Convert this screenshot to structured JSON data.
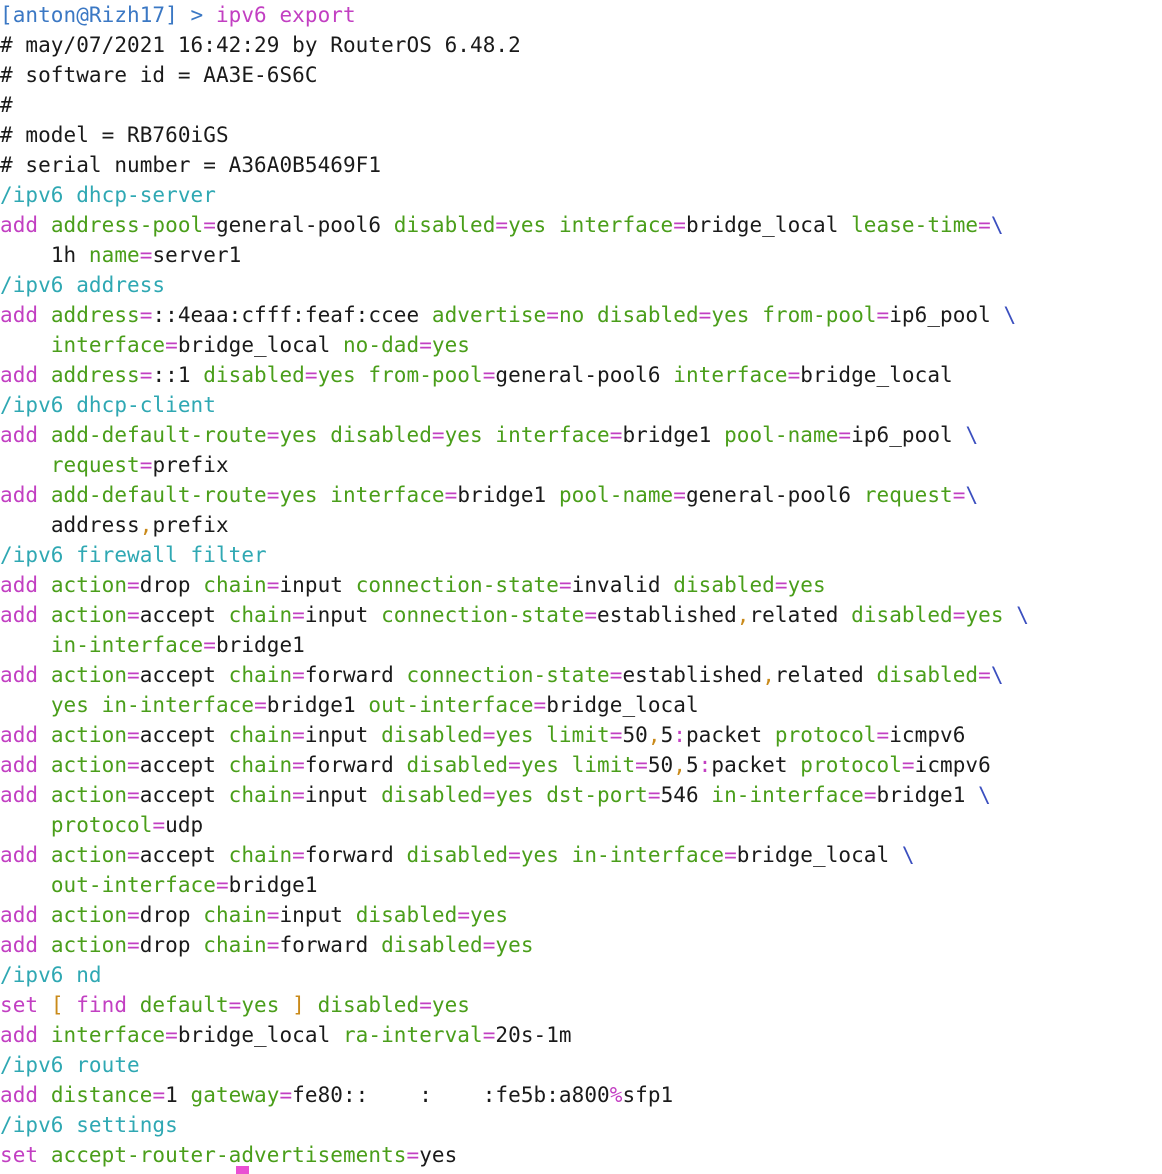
{
  "window": {
    "title": ""
  },
  "theme": {
    "background": "#ffffff",
    "prompt": "#3b78c4",
    "command": "#c23fc2",
    "path": "#2fa8b3",
    "verb": "#c23fc2",
    "param": "#4a9e1a",
    "value": "#1a1a1a",
    "continuation": "#3b4fbf",
    "punct": "#c98a1a",
    "cursor": "#e94fd3"
  },
  "lines": [
    [
      [
        "prompt",
        "[anton@Rizh17] > "
      ],
      [
        "cmd",
        "ipv6 "
      ],
      [
        "cmd",
        "export"
      ]
    ],
    [
      [
        "comment",
        "# may/07/2021 16:42:29 by RouterOS 6.48.2"
      ]
    ],
    [
      [
        "comment",
        "# software id = AA3E-6S6C"
      ]
    ],
    [
      [
        "comment",
        "#"
      ]
    ],
    [
      [
        "comment",
        "# model = RB760iGS"
      ]
    ],
    [
      [
        "comment",
        "# serial number = A36A0B5469F1"
      ]
    ],
    [
      [
        "path",
        "/ipv6 dhcp-server"
      ]
    ],
    [
      [
        "verb",
        "add "
      ],
      [
        "param",
        "address-pool"
      ],
      [
        "eq",
        "="
      ],
      [
        "value",
        "general-pool6 "
      ],
      [
        "param",
        "disabled"
      ],
      [
        "eq",
        "="
      ],
      [
        "param",
        "yes "
      ],
      [
        "param",
        "interface"
      ],
      [
        "eq",
        "="
      ],
      [
        "value",
        "bridge_local "
      ],
      [
        "param",
        "lease-time"
      ],
      [
        "eq",
        "="
      ],
      [
        "cont",
        "\\"
      ]
    ],
    [
      [
        "plain",
        "    "
      ],
      [
        "value",
        "1h "
      ],
      [
        "param",
        "name"
      ],
      [
        "eq",
        "="
      ],
      [
        "value",
        "server1"
      ]
    ],
    [
      [
        "path",
        "/ipv6 address"
      ]
    ],
    [
      [
        "verb",
        "add "
      ],
      [
        "param",
        "address"
      ],
      [
        "eq",
        "="
      ],
      [
        "value",
        "::4eaa:cfff:feaf:ccee "
      ],
      [
        "param",
        "advertise"
      ],
      [
        "eq",
        "="
      ],
      [
        "param",
        "no "
      ],
      [
        "param",
        "disabled"
      ],
      [
        "eq",
        "="
      ],
      [
        "param",
        "yes "
      ],
      [
        "param",
        "from-pool"
      ],
      [
        "eq",
        "="
      ],
      [
        "value",
        "ip6_pool "
      ],
      [
        "cont",
        "\\"
      ]
    ],
    [
      [
        "plain",
        "    "
      ],
      [
        "param",
        "interface"
      ],
      [
        "eq",
        "="
      ],
      [
        "value",
        "bridge_local "
      ],
      [
        "param",
        "no-dad"
      ],
      [
        "eq",
        "="
      ],
      [
        "param",
        "yes"
      ]
    ],
    [
      [
        "verb",
        "add "
      ],
      [
        "param",
        "address"
      ],
      [
        "eq",
        "="
      ],
      [
        "value",
        "::1 "
      ],
      [
        "param",
        "disabled"
      ],
      [
        "eq",
        "="
      ],
      [
        "param",
        "yes "
      ],
      [
        "param",
        "from-pool"
      ],
      [
        "eq",
        "="
      ],
      [
        "value",
        "general-pool6 "
      ],
      [
        "param",
        "interface"
      ],
      [
        "eq",
        "="
      ],
      [
        "value",
        "bridge_local"
      ]
    ],
    [
      [
        "path",
        "/ipv6 dhcp-client"
      ]
    ],
    [
      [
        "verb",
        "add "
      ],
      [
        "param",
        "add-default-route"
      ],
      [
        "eq",
        "="
      ],
      [
        "param",
        "yes "
      ],
      [
        "param",
        "disabled"
      ],
      [
        "eq",
        "="
      ],
      [
        "param",
        "yes "
      ],
      [
        "param",
        "interface"
      ],
      [
        "eq",
        "="
      ],
      [
        "value",
        "bridge1 "
      ],
      [
        "param",
        "pool-name"
      ],
      [
        "eq",
        "="
      ],
      [
        "value",
        "ip6_pool "
      ],
      [
        "cont",
        "\\"
      ]
    ],
    [
      [
        "plain",
        "    "
      ],
      [
        "param",
        "request"
      ],
      [
        "eq",
        "="
      ],
      [
        "value",
        "prefix"
      ]
    ],
    [
      [
        "verb",
        "add "
      ],
      [
        "param",
        "add-default-route"
      ],
      [
        "eq",
        "="
      ],
      [
        "param",
        "yes "
      ],
      [
        "param",
        "interface"
      ],
      [
        "eq",
        "="
      ],
      [
        "value",
        "bridge1 "
      ],
      [
        "param",
        "pool-name"
      ],
      [
        "eq",
        "="
      ],
      [
        "value",
        "general-pool6 "
      ],
      [
        "param",
        "request"
      ],
      [
        "eq",
        "="
      ],
      [
        "cont",
        "\\"
      ]
    ],
    [
      [
        "plain",
        "    "
      ],
      [
        "value",
        "address"
      ],
      [
        "punct",
        ","
      ],
      [
        "value",
        "prefix"
      ]
    ],
    [
      [
        "path",
        "/ipv6 firewall filter"
      ]
    ],
    [
      [
        "verb",
        "add "
      ],
      [
        "param",
        "action"
      ],
      [
        "eq",
        "="
      ],
      [
        "value",
        "drop "
      ],
      [
        "param",
        "chain"
      ],
      [
        "eq",
        "="
      ],
      [
        "value",
        "input "
      ],
      [
        "param",
        "connection-state"
      ],
      [
        "eq",
        "="
      ],
      [
        "value",
        "invalid "
      ],
      [
        "param",
        "disabled"
      ],
      [
        "eq",
        "="
      ],
      [
        "param",
        "yes"
      ]
    ],
    [
      [
        "verb",
        "add "
      ],
      [
        "param",
        "action"
      ],
      [
        "eq",
        "="
      ],
      [
        "value",
        "accept "
      ],
      [
        "param",
        "chain"
      ],
      [
        "eq",
        "="
      ],
      [
        "value",
        "input "
      ],
      [
        "param",
        "connection-state"
      ],
      [
        "eq",
        "="
      ],
      [
        "value",
        "established"
      ],
      [
        "punct",
        ","
      ],
      [
        "value",
        "related "
      ],
      [
        "param",
        "disabled"
      ],
      [
        "eq",
        "="
      ],
      [
        "param",
        "yes "
      ],
      [
        "cont",
        "\\"
      ]
    ],
    [
      [
        "plain",
        "    "
      ],
      [
        "param",
        "in-interface"
      ],
      [
        "eq",
        "="
      ],
      [
        "value",
        "bridge1"
      ]
    ],
    [
      [
        "verb",
        "add "
      ],
      [
        "param",
        "action"
      ],
      [
        "eq",
        "="
      ],
      [
        "value",
        "accept "
      ],
      [
        "param",
        "chain"
      ],
      [
        "eq",
        "="
      ],
      [
        "value",
        "forward "
      ],
      [
        "param",
        "connection-state"
      ],
      [
        "eq",
        "="
      ],
      [
        "value",
        "established"
      ],
      [
        "punct",
        ","
      ],
      [
        "value",
        "related "
      ],
      [
        "param",
        "disabled"
      ],
      [
        "eq",
        "="
      ],
      [
        "cont",
        "\\"
      ]
    ],
    [
      [
        "plain",
        "    "
      ],
      [
        "param",
        "yes "
      ],
      [
        "param",
        "in-interface"
      ],
      [
        "eq",
        "="
      ],
      [
        "value",
        "bridge1 "
      ],
      [
        "param",
        "out-interface"
      ],
      [
        "eq",
        "="
      ],
      [
        "value",
        "bridge_local"
      ]
    ],
    [
      [
        "verb",
        "add "
      ],
      [
        "param",
        "action"
      ],
      [
        "eq",
        "="
      ],
      [
        "value",
        "accept "
      ],
      [
        "param",
        "chain"
      ],
      [
        "eq",
        "="
      ],
      [
        "value",
        "input "
      ],
      [
        "param",
        "disabled"
      ],
      [
        "eq",
        "="
      ],
      [
        "param",
        "yes "
      ],
      [
        "param",
        "limit"
      ],
      [
        "eq",
        "="
      ],
      [
        "value",
        "50"
      ],
      [
        "punct",
        ","
      ],
      [
        "value",
        "5"
      ],
      [
        "eq",
        ":"
      ],
      [
        "value",
        "packet "
      ],
      [
        "param",
        "protocol"
      ],
      [
        "eq",
        "="
      ],
      [
        "value",
        "icmpv6"
      ]
    ],
    [
      [
        "verb",
        "add "
      ],
      [
        "param",
        "action"
      ],
      [
        "eq",
        "="
      ],
      [
        "value",
        "accept "
      ],
      [
        "param",
        "chain"
      ],
      [
        "eq",
        "="
      ],
      [
        "value",
        "forward "
      ],
      [
        "param",
        "disabled"
      ],
      [
        "eq",
        "="
      ],
      [
        "param",
        "yes "
      ],
      [
        "param",
        "limit"
      ],
      [
        "eq",
        "="
      ],
      [
        "value",
        "50"
      ],
      [
        "punct",
        ","
      ],
      [
        "value",
        "5"
      ],
      [
        "eq",
        ":"
      ],
      [
        "value",
        "packet "
      ],
      [
        "param",
        "protocol"
      ],
      [
        "eq",
        "="
      ],
      [
        "value",
        "icmpv6"
      ]
    ],
    [
      [
        "verb",
        "add "
      ],
      [
        "param",
        "action"
      ],
      [
        "eq",
        "="
      ],
      [
        "value",
        "accept "
      ],
      [
        "param",
        "chain"
      ],
      [
        "eq",
        "="
      ],
      [
        "value",
        "input "
      ],
      [
        "param",
        "disabled"
      ],
      [
        "eq",
        "="
      ],
      [
        "param",
        "yes "
      ],
      [
        "param",
        "dst-port"
      ],
      [
        "eq",
        "="
      ],
      [
        "value",
        "546 "
      ],
      [
        "param",
        "in-interface"
      ],
      [
        "eq",
        "="
      ],
      [
        "value",
        "bridge1 "
      ],
      [
        "cont",
        "\\"
      ]
    ],
    [
      [
        "plain",
        "    "
      ],
      [
        "param",
        "protocol"
      ],
      [
        "eq",
        "="
      ],
      [
        "value",
        "udp"
      ]
    ],
    [
      [
        "verb",
        "add "
      ],
      [
        "param",
        "action"
      ],
      [
        "eq",
        "="
      ],
      [
        "value",
        "accept "
      ],
      [
        "param",
        "chain"
      ],
      [
        "eq",
        "="
      ],
      [
        "value",
        "forward "
      ],
      [
        "param",
        "disabled"
      ],
      [
        "eq",
        "="
      ],
      [
        "param",
        "yes "
      ],
      [
        "param",
        "in-interface"
      ],
      [
        "eq",
        "="
      ],
      [
        "value",
        "bridge_local "
      ],
      [
        "cont",
        "\\"
      ]
    ],
    [
      [
        "plain",
        "    "
      ],
      [
        "param",
        "out-interface"
      ],
      [
        "eq",
        "="
      ],
      [
        "value",
        "bridge1"
      ]
    ],
    [
      [
        "verb",
        "add "
      ],
      [
        "param",
        "action"
      ],
      [
        "eq",
        "="
      ],
      [
        "value",
        "drop "
      ],
      [
        "param",
        "chain"
      ],
      [
        "eq",
        "="
      ],
      [
        "value",
        "input "
      ],
      [
        "param",
        "disabled"
      ],
      [
        "eq",
        "="
      ],
      [
        "param",
        "yes"
      ]
    ],
    [
      [
        "verb",
        "add "
      ],
      [
        "param",
        "action"
      ],
      [
        "eq",
        "="
      ],
      [
        "value",
        "drop "
      ],
      [
        "param",
        "chain"
      ],
      [
        "eq",
        "="
      ],
      [
        "value",
        "forward "
      ],
      [
        "param",
        "disabled"
      ],
      [
        "eq",
        "="
      ],
      [
        "param",
        "yes"
      ]
    ],
    [
      [
        "path",
        "/ipv6 nd"
      ]
    ],
    [
      [
        "verb",
        "set "
      ],
      [
        "punct",
        "[ "
      ],
      [
        "verb",
        "find "
      ],
      [
        "param",
        "default"
      ],
      [
        "eq",
        "="
      ],
      [
        "param",
        "yes "
      ],
      [
        "punct",
        "] "
      ],
      [
        "param",
        "disabled"
      ],
      [
        "eq",
        "="
      ],
      [
        "param",
        "yes"
      ]
    ],
    [
      [
        "verb",
        "add "
      ],
      [
        "param",
        "interface"
      ],
      [
        "eq",
        "="
      ],
      [
        "value",
        "bridge_local "
      ],
      [
        "param",
        "ra-interval"
      ],
      [
        "eq",
        "="
      ],
      [
        "value",
        "20s-1m"
      ]
    ],
    [
      [
        "path",
        "/ipv6 route"
      ]
    ],
    [
      [
        "verb",
        "add "
      ],
      [
        "param",
        "distance"
      ],
      [
        "eq",
        "="
      ],
      [
        "value",
        "1 "
      ],
      [
        "param",
        "gateway"
      ],
      [
        "eq",
        "="
      ],
      [
        "value",
        "fe80::"
      ],
      [
        "redact",
        "    "
      ],
      [
        "value",
        ":"
      ],
      [
        "redact",
        "    "
      ],
      [
        "value",
        ":fe5b:a800"
      ],
      [
        "eq",
        "%"
      ],
      [
        "value",
        "sfp1"
      ]
    ],
    [
      [
        "path",
        "/ipv6 settings"
      ]
    ],
    [
      [
        "verb",
        "set "
      ],
      [
        "param",
        "accept-router-advertisements"
      ],
      [
        "eq",
        "="
      ],
      [
        "value",
        "yes"
      ]
    ]
  ]
}
